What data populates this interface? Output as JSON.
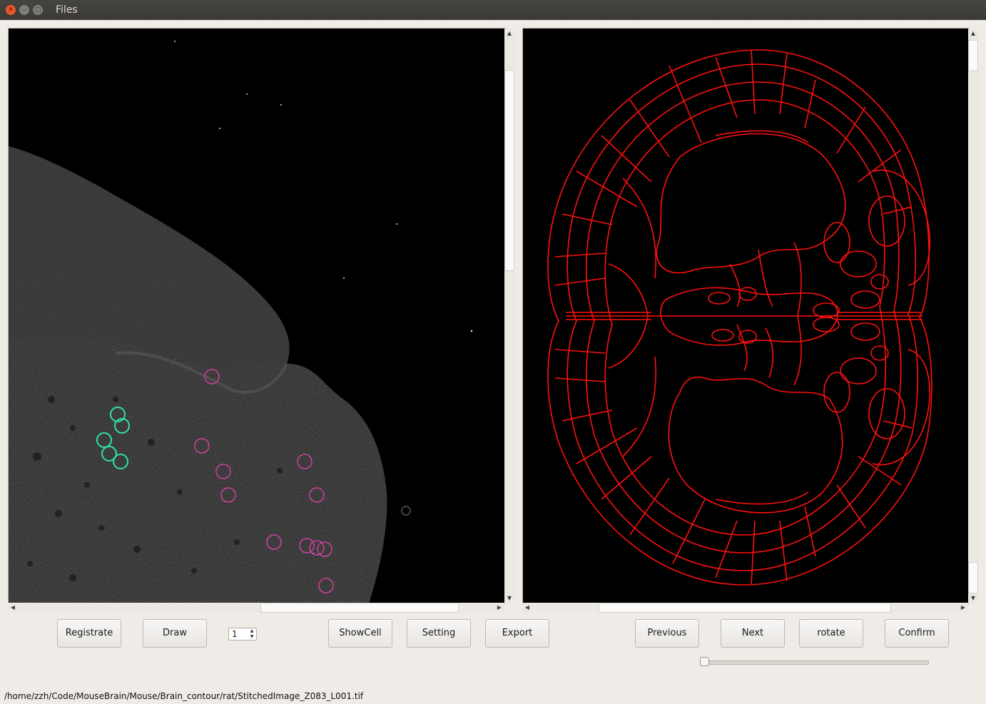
{
  "window": {
    "title": "Files"
  },
  "left_view": {
    "name": "microscopy-view"
  },
  "right_view": {
    "name": "atlas-contour-view",
    "contour_color": "#ff1010"
  },
  "cell_markers": {
    "green": "#2fe3a0",
    "magenta": "#d0409e"
  },
  "buttons": {
    "registrate": "Registrate",
    "draw": "Draw",
    "showcell": "ShowCell",
    "setting": "Setting",
    "export": "Export",
    "previous": "Previous",
    "next": "Next",
    "rotate": "rotate",
    "confirm": "Confirm"
  },
  "spinbox": {
    "value": "1"
  },
  "slider": {
    "value_fraction": 0.0
  },
  "status_bar": {
    "path": "/home/zzh/Code/MouseBrain/Mouse/Brain_contour/rat/StitchedImage_Z083_L001.tif"
  }
}
